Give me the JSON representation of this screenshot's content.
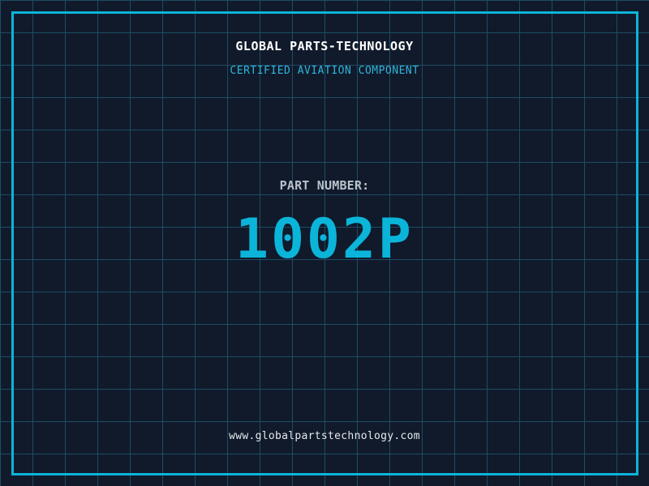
{
  "page": {
    "title": "GLOBAL PARTS-TECHNOLOGY",
    "subtitle": "CERTIFIED AVIATION COMPONENT",
    "part_number_label": "PART NUMBER:",
    "part_number": "1002P",
    "website": "www.globalpartstechnology.com"
  },
  "colors": {
    "background": "#101a2b",
    "grid_line": "#1d4d64",
    "border": "#0db4d9",
    "accent_cyan": "#2fb5db",
    "part_cyan": "#0ab5d9",
    "title_white": "#ffffff",
    "label_gray": "#b9c2cb",
    "url_white": "#e6e9ec"
  },
  "layout_meta": {
    "grid_cell_px": "40"
  }
}
